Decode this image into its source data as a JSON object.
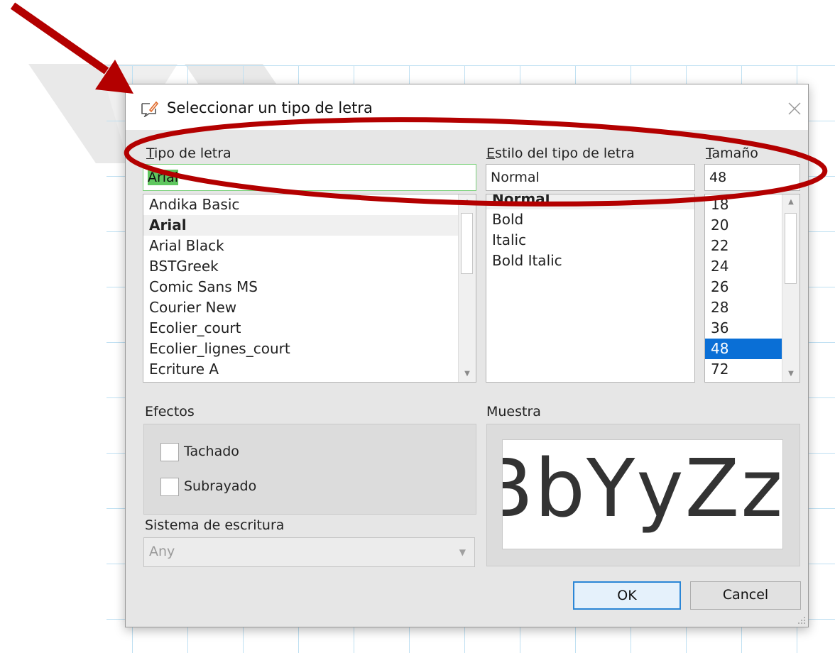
{
  "dialog": {
    "title": "Seleccionar un tipo de letra"
  },
  "font": {
    "label": "Tipo de letra",
    "value": "Arial",
    "items": [
      "Andika Basic",
      "Arial",
      "Arial Black",
      "BSTGreek",
      "Comic Sans MS",
      "Courier New",
      "Ecolier_court",
      "Ecolier_lignes_court",
      "Ecriture A"
    ],
    "current_index": 1
  },
  "style": {
    "label": "Estilo del tipo de letra",
    "value": "Normal",
    "items": [
      "Normal",
      "Bold",
      "Italic",
      "Bold Italic"
    ]
  },
  "size": {
    "label": "Tamaño",
    "value": "48",
    "items": [
      "18",
      "20",
      "22",
      "24",
      "26",
      "28",
      "36",
      "48",
      "72"
    ],
    "selected_index": 7
  },
  "effects": {
    "label": "Efectos",
    "strikeout_label": "Tachado",
    "strikeout_checked": false,
    "underline_label": "Subrayado",
    "underline_checked": false
  },
  "writing_system": {
    "label": "Sistema de escritura",
    "value": "Any"
  },
  "sample": {
    "label": "Muestra",
    "text": "BbYyZz"
  },
  "buttons": {
    "ok": "OK",
    "cancel": "Cancel"
  },
  "colors": {
    "annotation": "#c00000",
    "selection": "#0a6fd6",
    "text_highlight": "#5fc75f",
    "ok_border": "#2b86d6"
  },
  "icons": {
    "title": "font-dialog-icon",
    "close": "close-icon",
    "scroll_up": "scroll-up-icon",
    "scroll_down": "scroll-down-icon",
    "combo": "chevron-down-icon",
    "resize": "resize-grip-icon"
  }
}
